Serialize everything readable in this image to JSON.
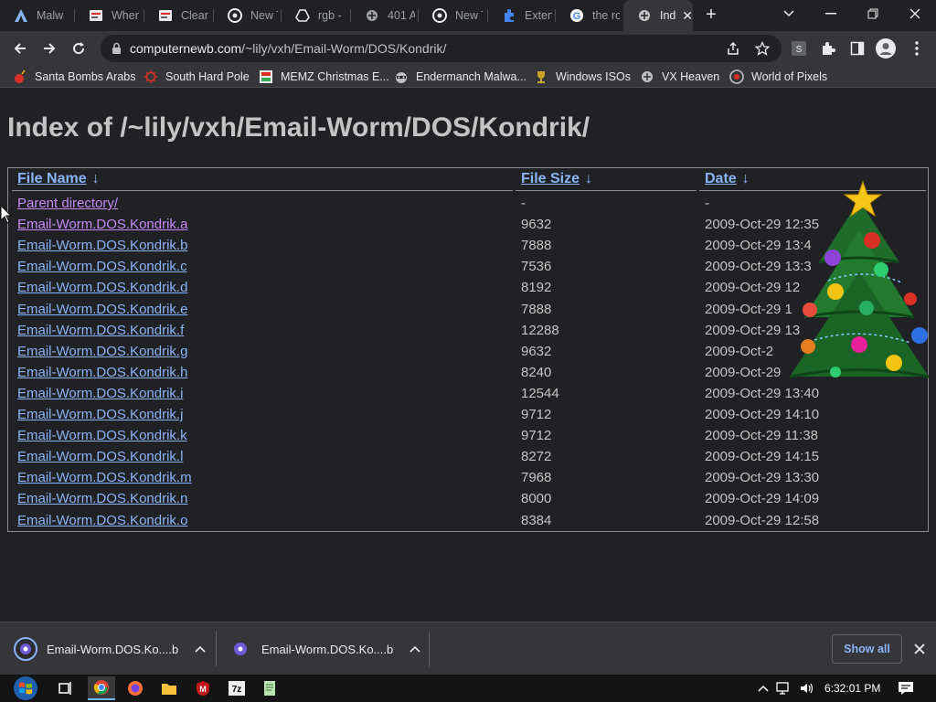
{
  "tabs": [
    {
      "title": "Malwa",
      "icon": "malware-site-icon"
    },
    {
      "title": "When",
      "icon": "doc-icon"
    },
    {
      "title": "Clear",
      "icon": "doc-icon"
    },
    {
      "title": "New T",
      "icon": "chrome-icon"
    },
    {
      "title": "rgb - S",
      "icon": "drive-icon"
    },
    {
      "title": "401 A",
      "icon": "site-icon"
    },
    {
      "title": "New T",
      "icon": "chrome-icon"
    },
    {
      "title": "Extens",
      "icon": "puzzle-icon"
    },
    {
      "title": "the ro",
      "icon": "google-icon"
    },
    {
      "title": "Ind",
      "icon": "site-icon",
      "active": true
    }
  ],
  "address": {
    "host": "computernewb.com",
    "path": "/~lily/vxh/Email-Worm/DOS/Kondrik/"
  },
  "bookmarks": [
    {
      "label": "Santa Bombs Arabs",
      "icon": "bomb-icon",
      "color": "#d93025"
    },
    {
      "label": "South Hard Pole",
      "icon": "virus-icon",
      "color": "#d93025"
    },
    {
      "label": "MEMZ Christmas E...",
      "icon": "memz-icon"
    },
    {
      "label": "Endermanch Malwa...",
      "icon": "raccoon-icon"
    },
    {
      "label": "Windows ISOs",
      "icon": "trophy-icon"
    },
    {
      "label": "VX Heaven",
      "icon": "site-icon"
    },
    {
      "label": "World of Pixels",
      "icon": "pixel-icon"
    }
  ],
  "page": {
    "title": "Index of /~lily/vxh/Email-Worm/DOS/Kondrik/",
    "columns": {
      "name": "File Name",
      "size": "File Size",
      "date": "Date",
      "sort_glyph": "↓"
    },
    "rows": [
      {
        "name": "Parent directory/",
        "size": "-",
        "date": "-",
        "visited": true
      },
      {
        "name": "Email-Worm.DOS.Kondrik.a",
        "size": "9632",
        "date": "2009-Oct-29 12:35",
        "visited": true
      },
      {
        "name": "Email-Worm.DOS.Kondrik.b",
        "size": "7888",
        "date": "2009-Oct-29 13:4"
      },
      {
        "name": "Email-Worm.DOS.Kondrik.c",
        "size": "7536",
        "date": "2009-Oct-29 13:3"
      },
      {
        "name": "Email-Worm.DOS.Kondrik.d",
        "size": "8192",
        "date": "2009-Oct-29 12"
      },
      {
        "name": "Email-Worm.DOS.Kondrik.e",
        "size": "7888",
        "date": "2009-Oct-29 1"
      },
      {
        "name": "Email-Worm.DOS.Kondrik.f",
        "size": "12288",
        "date": "2009-Oct-29 13"
      },
      {
        "name": "Email-Worm.DOS.Kondrik.g",
        "size": "9632",
        "date": "2009-Oct-2"
      },
      {
        "name": "Email-Worm.DOS.Kondrik.h",
        "size": "8240",
        "date": "2009-Oct-29"
      },
      {
        "name": "Email-Worm.DOS.Kondrik.i",
        "size": "12544",
        "date": "2009-Oct-29 13:40"
      },
      {
        "name": "Email-Worm.DOS.Kondrik.j",
        "size": "9712",
        "date": "2009-Oct-29 14:10"
      },
      {
        "name": "Email-Worm.DOS.Kondrik.k",
        "size": "9712",
        "date": "2009-Oct-29 11:38"
      },
      {
        "name": "Email-Worm.DOS.Kondrik.l",
        "size": "8272",
        "date": "2009-Oct-29 14:15"
      },
      {
        "name": "Email-Worm.DOS.Kondrik.m",
        "size": "7968",
        "date": "2009-Oct-29 13:30"
      },
      {
        "name": "Email-Worm.DOS.Kondrik.n",
        "size": "8000",
        "date": "2009-Oct-29 14:09"
      },
      {
        "name": "Email-Worm.DOS.Kondrik.o",
        "size": "8384",
        "date": "2009-Oct-29 12:58"
      }
    ]
  },
  "downloads": [
    {
      "name": "Email-Worm.DOS.Ko....b",
      "icon": "file-icon"
    },
    {
      "name": "Email-Worm.DOS.Ko....b",
      "icon": "file-icon"
    }
  ],
  "shelf": {
    "show_all": "Show all"
  },
  "taskbar": {
    "clock": "6:32:01 PM"
  },
  "colors": {
    "link": "#8ab4f8",
    "visited": "#c58af9",
    "text": "#c3c4c6",
    "bg": "#202124"
  }
}
